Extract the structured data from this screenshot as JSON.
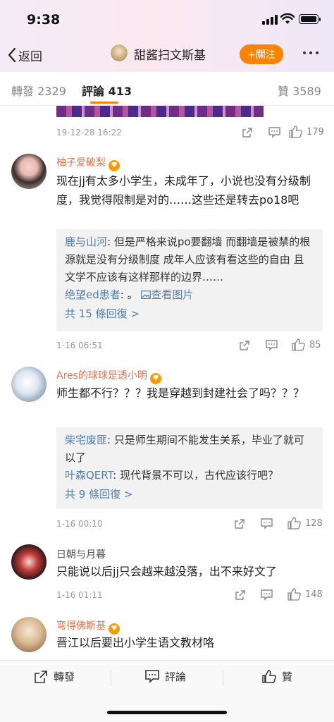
{
  "status": {
    "time": "9:38"
  },
  "nav": {
    "back_label": "返回",
    "title": "甜酱扫文斯基",
    "follow_label": "+關注"
  },
  "tabs": [
    {
      "label": "轉發",
      "count": "2329"
    },
    {
      "label": "評論",
      "count": "413"
    },
    {
      "label": "贊",
      "count": "3589"
    }
  ],
  "prev_comment": {
    "time": "19-12-28 16:22",
    "likes": "179"
  },
  "comments": [
    {
      "user": "柚子爱破梨",
      "text": "现在jj有太多小学生，未成年了，小说也没有分级制度，我觉得限制是对的……这些还是转去po18吧",
      "replies": [
        {
          "user": "鹿与山河",
          "text": "但是严格来说po要翻墙 而翻墙是被禁的根源就是没有分级制度 成年人应该有看这些的自由 且文学不应该有这样那样的边界……"
        },
        {
          "user": "绝望ed患者",
          "text": "。",
          "extra": "查看图片"
        }
      ],
      "more_replies": "共 15 條回復 >",
      "time": "1-16 06:51",
      "likes": "85"
    },
    {
      "user": "Ares的球球是透小明",
      "text": "师生都不行？？？我是穿越到封建社会了吗？？？",
      "replies": [
        {
          "user": "柴宅废匪",
          "text": "只是师生期间不能发生关系，毕业了就可以了"
        },
        {
          "user": "叶森QERT",
          "text": "现代背景不可以，古代应该行吧？"
        }
      ],
      "more_replies": "共 9 條回復 >",
      "time": "1-16 00:10",
      "likes": "128"
    },
    {
      "user": "日朝与月暮",
      "text": "只能说以后jj只会越来越没落，出不来好文了",
      "time": "1-16 01:11",
      "likes": "148"
    },
    {
      "user": "弯得佛斯基",
      "text": "晋江以后要出小学生语文教材咯"
    }
  ],
  "bottom_bar": {
    "repost": "轉發",
    "comment": "評論",
    "like": "贊"
  },
  "colors": {
    "accent": "#ff8200",
    "username": "#eb7350",
    "reply_name": "#507daf"
  }
}
